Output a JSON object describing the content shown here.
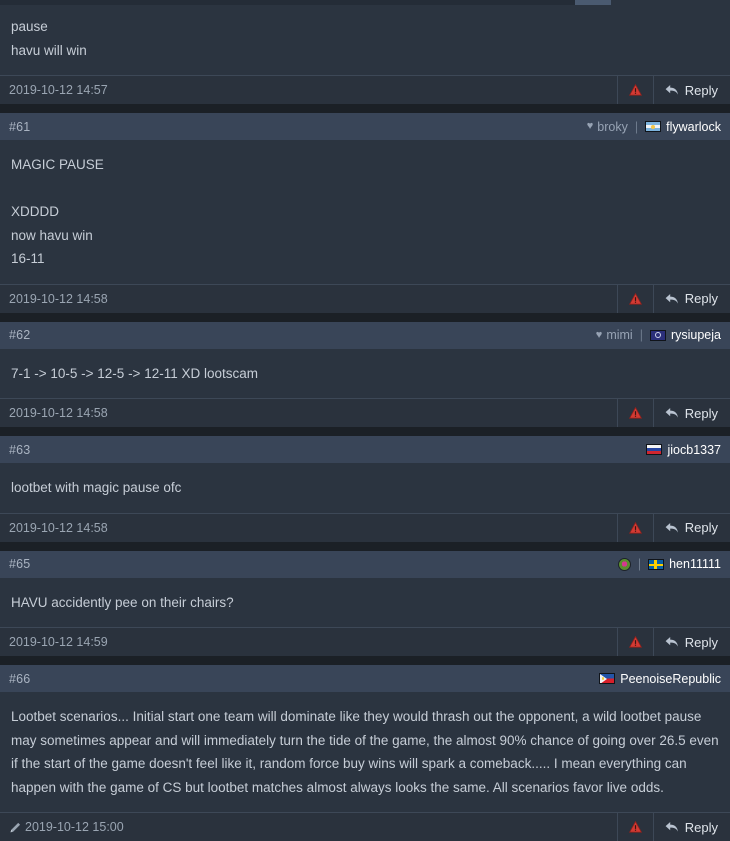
{
  "page": {
    "title": "HLTV forum thread comments",
    "colors": {
      "page_bg": "#2b3440",
      "header_bg": "#394558",
      "footer_bg": "#2a323d",
      "separator": "#1b2026",
      "text": "#c6cdd6",
      "username": "#ffffff",
      "muted": "#97a3b4",
      "warning_red": "#d33a33"
    }
  },
  "labels": {
    "reply": "Reply",
    "divider": "|",
    "heart_icon": "heart-icon",
    "warning_icon": "warning-triangle-icon",
    "reply_icon": "reply-arrow-icon",
    "edited_icon": "pencil-edited-icon"
  },
  "posts": [
    {
      "id": "post-clipped",
      "number": "",
      "clipped": true,
      "favorite": null,
      "badge": false,
      "flag": null,
      "username": "",
      "lines": [
        "pause",
        "havu will win"
      ],
      "timestamp": "2019-10-12 14:57",
      "edited": false
    },
    {
      "id": "post-61",
      "number": "#61",
      "clipped": false,
      "favorite": "broky",
      "badge": false,
      "flag": "flag-ar",
      "flag_name": "argentina-flag-icon",
      "username": "flywarlock",
      "lines": [
        "MAGIC PAUSE",
        "",
        "XDDDD",
        "now havu win",
        "16-11"
      ],
      "timestamp": "2019-10-12 14:58",
      "edited": false
    },
    {
      "id": "post-62",
      "number": "#62",
      "clipped": false,
      "favorite": "mimi",
      "badge": false,
      "flag": "flag-eu",
      "flag_name": "europe-flag-icon",
      "username": "rysiupeja",
      "lines": [
        "7-1 -> 10-5 -> 12-5 -> 12-11 XD lootscam"
      ],
      "timestamp": "2019-10-12 14:58",
      "edited": false
    },
    {
      "id": "post-63",
      "number": "#63",
      "clipped": false,
      "favorite": null,
      "badge": false,
      "flag": "flag-ru",
      "flag_name": "russia-flag-icon",
      "username": "jiocb1337",
      "lines": [
        "lootbet with magic pause ofc"
      ],
      "timestamp": "2019-10-12 14:58",
      "edited": false
    },
    {
      "id": "post-65",
      "number": "#65",
      "clipped": false,
      "favorite": null,
      "badge": true,
      "badge_name": "user-badge-icon",
      "flag": "flag-se",
      "flag_name": "sweden-flag-icon",
      "username": "hen11111",
      "lines": [
        "HAVU accidently pee on their chairs?"
      ],
      "timestamp": "2019-10-12 14:59",
      "edited": false
    },
    {
      "id": "post-66",
      "number": "#66",
      "clipped": false,
      "favorite": null,
      "badge": false,
      "flag": "flag-ph",
      "flag_name": "philippines-flag-icon",
      "username": "PeenoiseRepublic",
      "lines": [
        "Lootbet scenarios... Initial start one team will dominate like they would thrash out the opponent, a wild lootbet pause may sometimes appear and will immediately turn the tide of the game, the almost 90% chance of going over 26.5 even if the start of the game doesn't feel like it, random force buy wins will spark a comeback..... I mean everything can happen with the game of CS but lootbet matches almost always looks the same. All scenarios favor live odds."
      ],
      "timestamp": "2019-10-12 15:00",
      "edited": true
    }
  ]
}
